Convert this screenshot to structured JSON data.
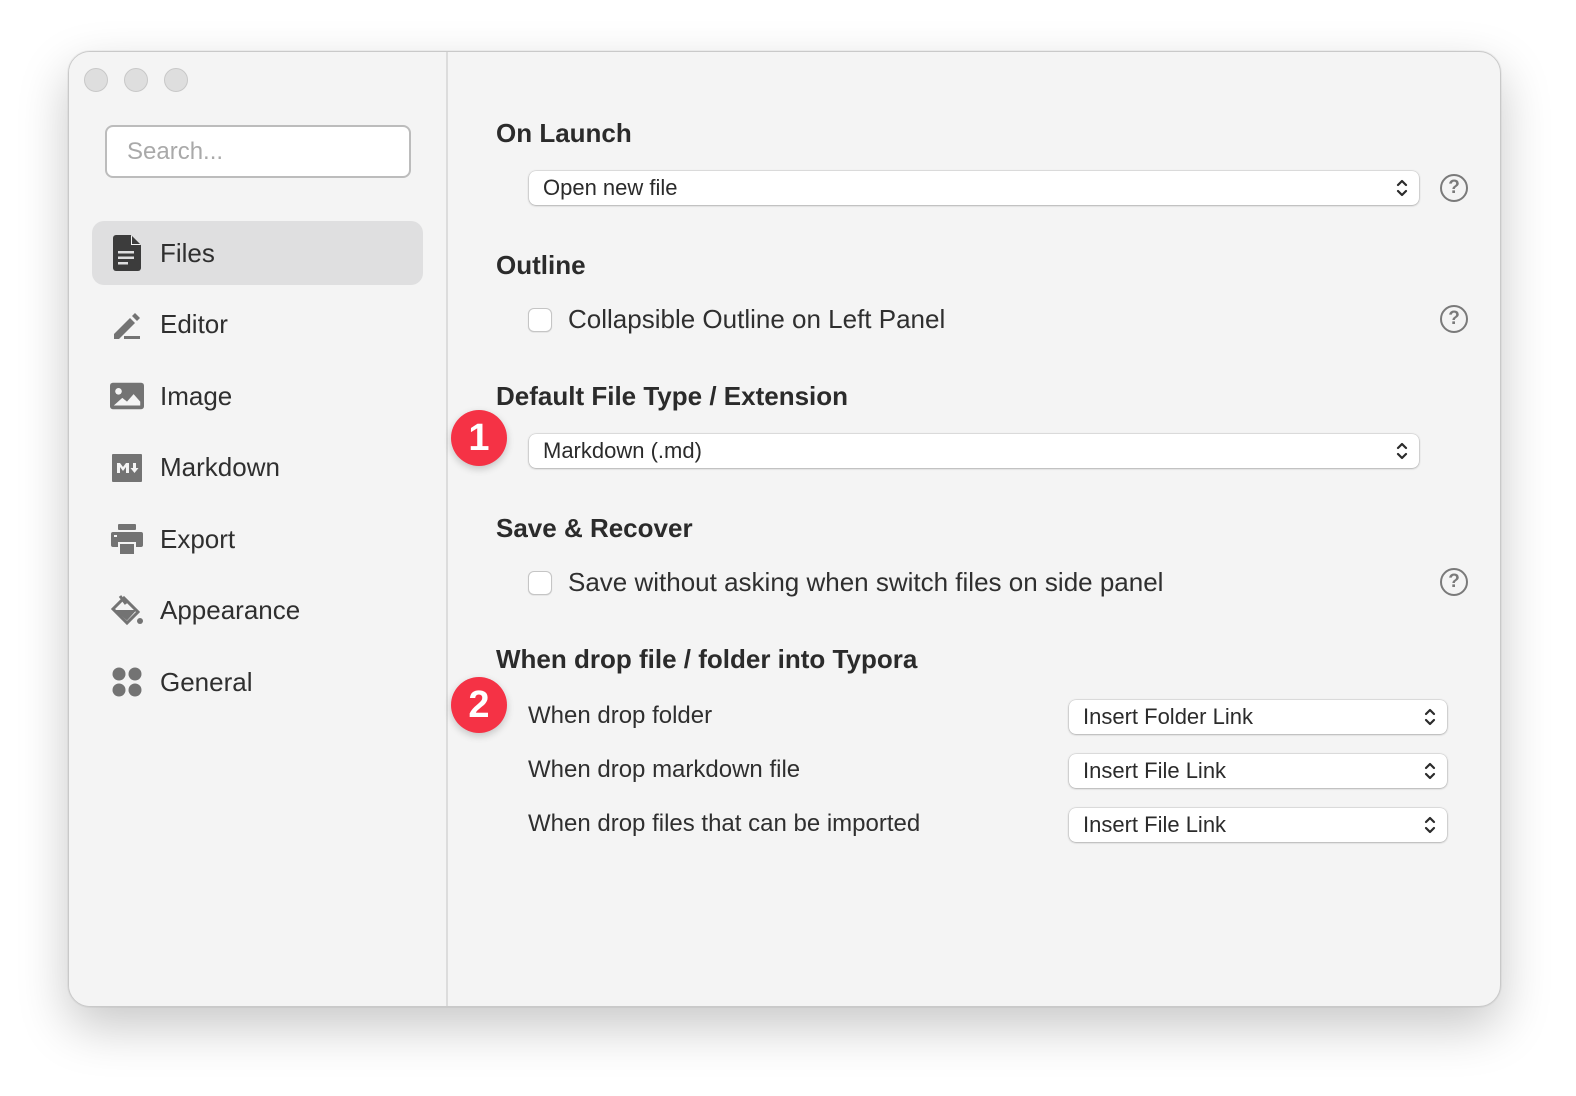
{
  "window": {
    "traffic_lights": [
      "close",
      "minimize",
      "zoom"
    ]
  },
  "sidebar": {
    "search": {
      "placeholder": "Search...",
      "value": ""
    },
    "items": [
      {
        "label": "Files",
        "icon": "file-icon",
        "active": true
      },
      {
        "label": "Editor",
        "icon": "pencil-icon",
        "active": false
      },
      {
        "label": "Image",
        "icon": "image-icon",
        "active": false
      },
      {
        "label": "Markdown",
        "icon": "markdown-icon",
        "active": false
      },
      {
        "label": "Export",
        "icon": "printer-icon",
        "active": false
      },
      {
        "label": "Appearance",
        "icon": "paint-bucket-icon",
        "active": false
      },
      {
        "label": "General",
        "icon": "grid-dots-icon",
        "active": false
      }
    ]
  },
  "content": {
    "on_launch": {
      "title": "On Launch",
      "select_value": "Open new file"
    },
    "outline": {
      "title": "Outline",
      "checkbox_label": "Collapsible Outline on Left Panel",
      "checked": false
    },
    "default_file_type": {
      "title": "Default File Type / Extension",
      "select_value": "Markdown (.md)",
      "badge": "1"
    },
    "save_recover": {
      "title": "Save & Recover",
      "checkbox_label": "Save without asking when switch files on side panel",
      "checked": false
    },
    "drop": {
      "title": "When drop file / folder into Typora",
      "badge": "2",
      "rows": [
        {
          "label": "When drop folder",
          "value": "Insert Folder Link"
        },
        {
          "label": "When drop markdown file",
          "value": "Insert File Link"
        },
        {
          "label": "When drop files that can be imported",
          "value": "Insert File Link"
        }
      ]
    },
    "help_symbol": "?"
  },
  "colors": {
    "badge": "#f53245",
    "window_bg": "#f4f4f4",
    "active_nav_bg": "#dfdfe0"
  }
}
